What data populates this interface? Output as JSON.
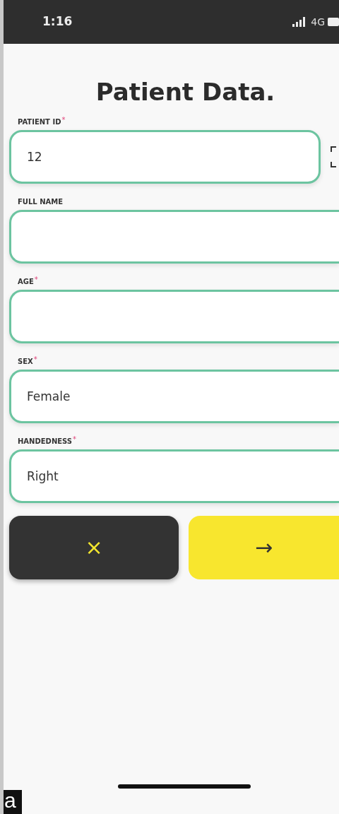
{
  "status_bar": {
    "time": "1:16",
    "network": "4G"
  },
  "title": "Patient Data.",
  "fields": [
    {
      "label": "PATIENT ID",
      "required_mark": "*",
      "value": "12",
      "scan_button": true
    },
    {
      "label": "FULL NAME"
    },
    {
      "label": "AGE",
      "required_mark": "*"
    },
    {
      "label": "SEX",
      "required_mark": "*",
      "value": "Female"
    },
    {
      "label": "HANDEDNESS",
      "required_mark": "*",
      "value": "Right"
    }
  ],
  "buttons": [
    {
      "kind": "cancel",
      "label": "×"
    },
    {
      "kind": "next",
      "label": "→"
    }
  ],
  "panel_label": "a"
}
